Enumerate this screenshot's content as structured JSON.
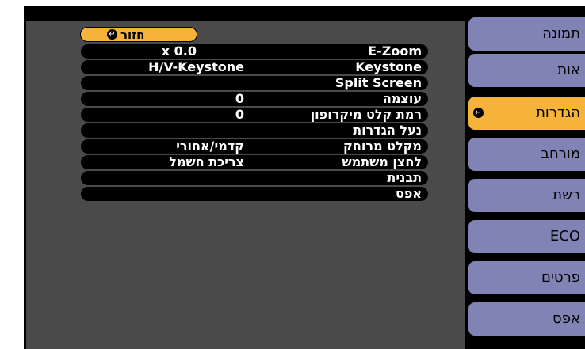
{
  "back_button": {
    "label": "חזור"
  },
  "rows": [
    {
      "label": "E-Zoom",
      "value": "x  0.0"
    },
    {
      "label": "Keystone",
      "value": "H/V-Keystone"
    },
    {
      "label": "Split Screen",
      "value": ""
    },
    {
      "label": "עוצמה",
      "value": "0"
    },
    {
      "label": "רמת קלט מיקרופון",
      "value": "0"
    },
    {
      "label": "נעל הגדרות",
      "value": ""
    },
    {
      "label": "מקלט מרוחק",
      "value": "קדמי/אחורי"
    },
    {
      "label": "לחצן משתמש",
      "value": "צריכת חשמל"
    },
    {
      "label": "תבנית",
      "value": ""
    },
    {
      "label": "אפס",
      "value": ""
    }
  ],
  "sidebar": {
    "items": [
      {
        "label": "תמונה"
      },
      {
        "label": "אות"
      },
      {
        "label": "הגדרות"
      },
      {
        "label": "מורחב"
      },
      {
        "label": "רשת"
      },
      {
        "label": "ECO"
      },
      {
        "label": "פרטים"
      },
      {
        "label": "אפס"
      }
    ],
    "active_index": 2
  },
  "colors": {
    "accent": "#f5b33a",
    "sidebar_bg": "#8183b4",
    "panel_bg": "#4a4a4a"
  },
  "icons": {
    "return": "return-arrow-icon"
  }
}
